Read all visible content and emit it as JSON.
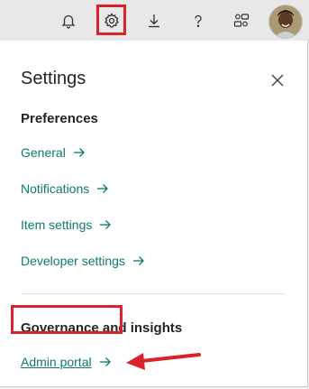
{
  "topbar": {
    "icons": [
      "bell-icon",
      "gear-icon",
      "download-icon",
      "help-icon",
      "feedback-icon",
      "avatar"
    ]
  },
  "settings": {
    "title": "Settings",
    "preferences_heading": "Preferences",
    "preferences_links": [
      "General",
      "Notifications",
      "Item settings",
      "Developer settings"
    ],
    "governance_heading": "Governance and insights",
    "governance_links": [
      "Admin portal"
    ]
  },
  "colors": {
    "link": "#0e7a6e",
    "annotation": "#d9222b",
    "topbar": "#e8e8e8"
  }
}
